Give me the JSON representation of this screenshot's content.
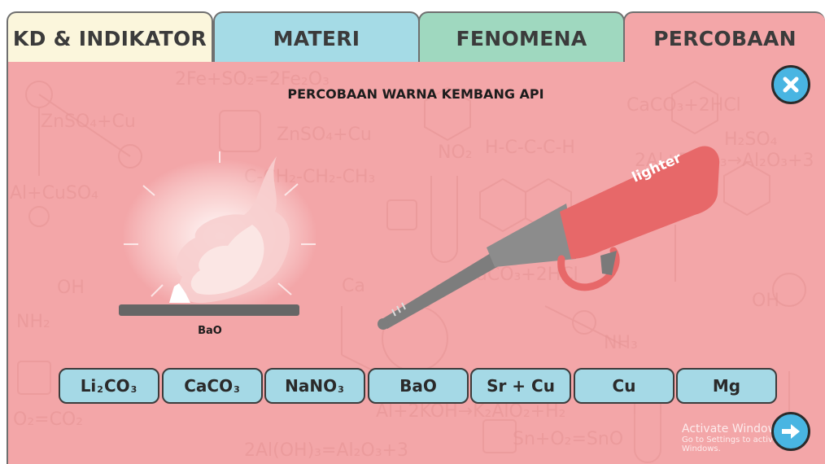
{
  "tabs": [
    {
      "label": "KD & INDIKATOR",
      "color": "#fbf6dc"
    },
    {
      "label": "MATERI",
      "color": "#a5dbe6"
    },
    {
      "label": "FENOMENA",
      "color": "#9fd8bf"
    },
    {
      "label": "PERCOBAAN",
      "color": "#f3a6a8",
      "active": true
    }
  ],
  "experiment": {
    "title": "PERCOBAAN WARNA KEMBANG API",
    "sample_label": "BaO",
    "lighter_label": "lighter"
  },
  "chemicals": [
    {
      "base": "Li",
      "sub": "2",
      "tail": "CO",
      "sub2": "3"
    },
    {
      "base": "CaCO",
      "sub": "3"
    },
    {
      "base": "NaNO",
      "sub": "3"
    },
    {
      "base": "BaO"
    },
    {
      "base": "Sr + Cu"
    },
    {
      "base": "Cu"
    },
    {
      "base": "Mg"
    }
  ],
  "buttons": {
    "close_icon": "close-icon",
    "next_icon": "arrow-right-icon"
  },
  "watermark": {
    "title": "Activate Windows",
    "subtitle": "Go to Settings to activate Windows."
  },
  "colors": {
    "panel": "#f3a6a8",
    "button_blue": "#49b5e2",
    "chem_button": "#a5d9e6",
    "lighter_red": "#e76869",
    "lighter_grey": "#8c8c8c"
  }
}
